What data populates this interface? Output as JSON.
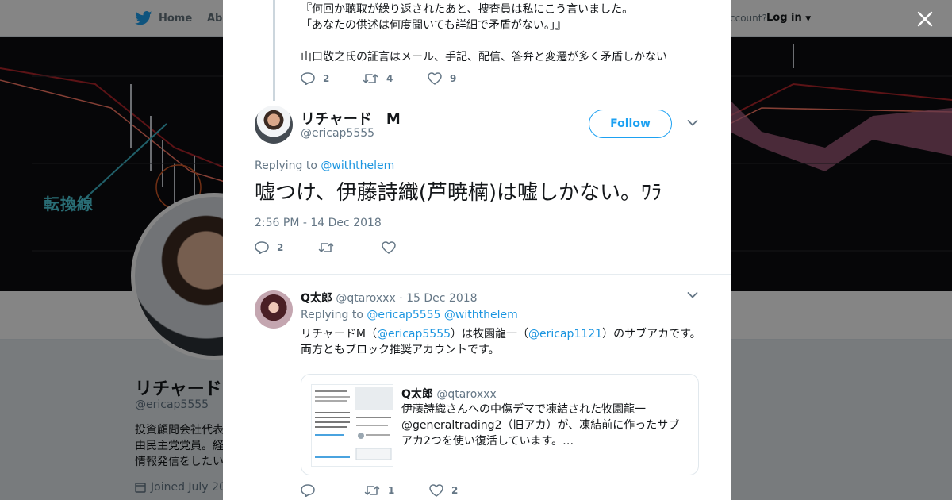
{
  "background": {
    "nav": {
      "home": "Home",
      "about": "Abo",
      "account": "ccount?",
      "login": "Log in"
    },
    "banner_label": "転換線",
    "profile": {
      "name": "リチャード",
      "handle": "@ericap5555",
      "bio": "投資顧問会社代表\n由民主党党員。経\n情報発信をしたい",
      "joined": "Joined July 20"
    }
  },
  "parent_tweet": {
    "text": "『何回か聴取が繰り返されたあと、捜査員は私にこう言いました。\n「あなたの供述は何度聞いても詳細で矛盾がない。」』\n\n山口敬之氏の証言はメール、手記、配信、答弁と変遷が多く矛盾しかない",
    "replies": "2",
    "retweets": "4",
    "likes": "9"
  },
  "main_tweet": {
    "name": "リチャード　M",
    "handle": "@ericap5555",
    "follow_label": "Follow",
    "replying_prefix": "Replying to",
    "replying_to": "@withthelem",
    "text": "嘘つけ、伊藤詩織(芦暁楠)は嘘しかない。ﾜﾗ",
    "timestamp": "2:56 PM - 14 Dec 2018",
    "replies": "2"
  },
  "reply_tweet": {
    "name": "Q太郎",
    "handle": "@qtaroxxx",
    "date": "· 15 Dec 2018",
    "replying_prefix": "Replying to",
    "replying_to_1": "@ericap5555",
    "replying_to_2": "@withthelem",
    "text_part1": "リチャードM（",
    "mention_1": "@ericap5555",
    "text_part2": "）は牧園龍一（",
    "mention_2": "@ericap1121",
    "text_part3": "）のサブアカです。両方ともブロック推奨アカウントです。",
    "quote": {
      "name": "Q太郎",
      "handle": "@qtaroxxx",
      "text": "伊藤詩織さんへの中傷デマで凍結された牧園龍一@generaltrading2（旧アカ）が、凍結前に作ったサブアカ2つを使い復活しています。…"
    },
    "retweets": "1",
    "likes": "2"
  },
  "colors": {
    "accent": "#1da1f2",
    "link": "#1b95e0",
    "muted": "#657786"
  }
}
